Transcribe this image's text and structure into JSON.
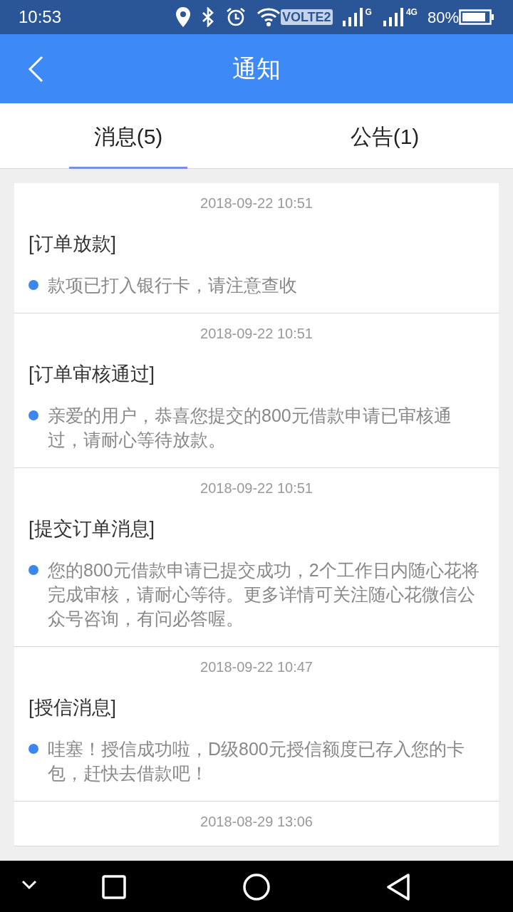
{
  "status_bar": {
    "time": "10:53",
    "volte": "VOLTE2",
    "network_1": "G",
    "network_2": "4G",
    "battery": "80%"
  },
  "header": {
    "title": "通知"
  },
  "tabs": [
    {
      "label": "消息(5)",
      "selected": true
    },
    {
      "label": "公告(1)",
      "selected": false
    }
  ],
  "messages": [
    {
      "time": "2018-09-22 10:51",
      "title": "[订单放款]",
      "body": "款项已打入银行卡，请注意查收",
      "unread": true
    },
    {
      "time": "2018-09-22 10:51",
      "title": "[订单审核通过]",
      "body": "亲爱的用户，恭喜您提交的800元借款申请已审核通过，请耐心等待放款。",
      "unread": true
    },
    {
      "time": "2018-09-22 10:51",
      "title": "[提交订单消息]",
      "body": "您的800元借款申请已提交成功，2个工作日内随心花将完成审核，请耐心等待。更多详情可关注随心花微信公众号咨询，有问必答喔。",
      "unread": true
    },
    {
      "time": "2018-09-22 10:47",
      "title": "[授信消息]",
      "body": "哇塞！授信成功啦，D级800元授信额度已存入您的卡包，赶快去借款吧！",
      "unread": true
    },
    {
      "time": "2018-08-29 13:06"
    }
  ]
}
